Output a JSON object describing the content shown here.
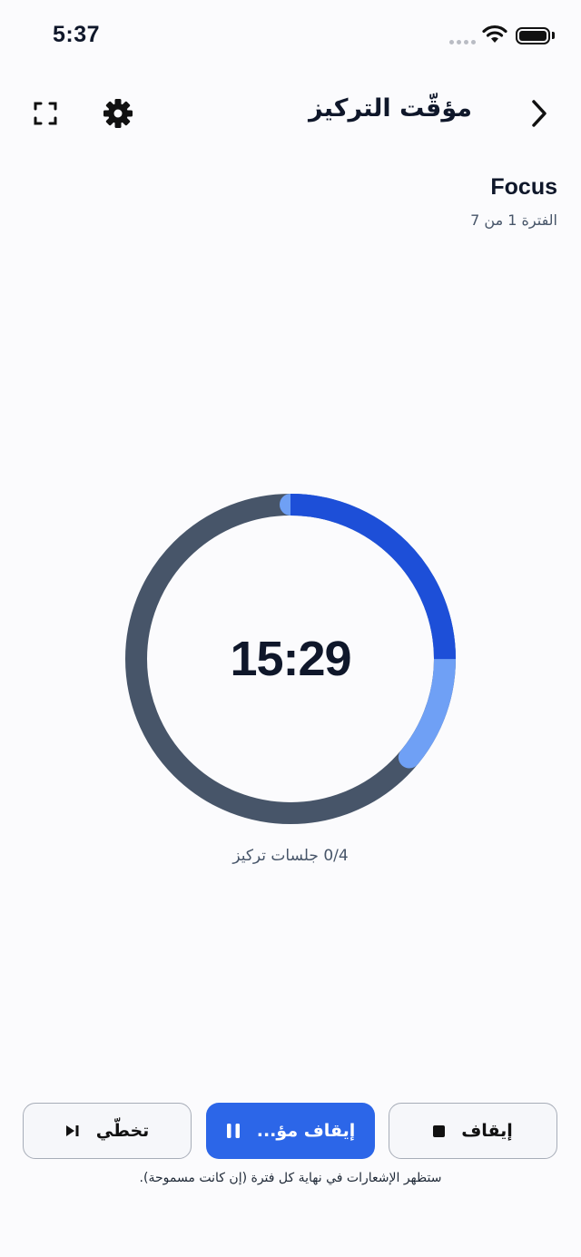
{
  "status_bar": {
    "time": "5:37"
  },
  "header": {
    "title": "مؤقّت التركيز"
  },
  "phase": {
    "title": "Focus",
    "subtitle": "الفترة 1 من 7"
  },
  "timer": {
    "time_left": "15:29",
    "progress_fraction": 0.36,
    "sessions": "0/4 جلسات تركيز"
  },
  "controls": {
    "skip_label": "تخطّي",
    "pause_label": "إيقاف مؤ...",
    "stop_label": "إيقاف"
  },
  "footnote": "ستظهر الإشعارات في نهاية كل فترة (إن كانت مسموحة).",
  "colors": {
    "accent": "#2c66e8",
    "progress_dark": "#1d4fd8",
    "progress_light": "#6fa0f5",
    "track": "#475569"
  }
}
